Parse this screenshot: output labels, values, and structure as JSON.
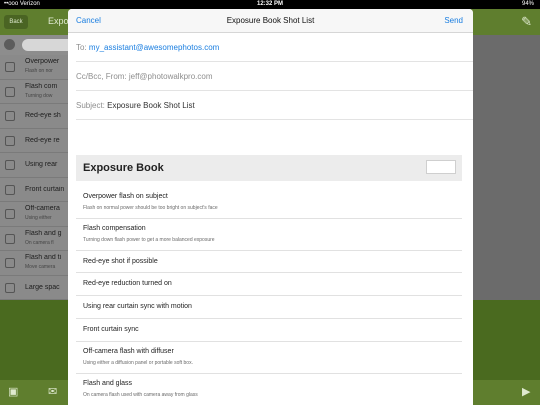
{
  "status_bar": {
    "carrier": "••ooo Verizon",
    "time": "12:32 PM",
    "battery": "94%"
  },
  "background": {
    "back_label": "Back",
    "title": "Expo",
    "list": [
      {
        "title": "Overpower",
        "subtitle": "Flash on nor"
      },
      {
        "title": "Flash com",
        "subtitle": "Turning dow"
      },
      {
        "title": "Red-eye sh",
        "subtitle": ""
      },
      {
        "title": "Red-eye re",
        "subtitle": ""
      },
      {
        "title": "Using rear",
        "subtitle": ""
      },
      {
        "title": "Front curtain",
        "subtitle": ""
      },
      {
        "title": "Off-camera",
        "subtitle": "Using either"
      },
      {
        "title": "Flash and g",
        "subtitle": "On camera fl"
      },
      {
        "title": "Flash and ti",
        "subtitle": "Move camera"
      },
      {
        "title": "Large spac",
        "subtitle": ""
      }
    ]
  },
  "compose": {
    "cancel": "Cancel",
    "title": "Exposure Book Shot List",
    "send": "Send",
    "to_label": "To:",
    "to_value": "my_assistant@awesomephotos.com",
    "ccbcc_label": "Cc/Bcc, From:",
    "from_value": "jeff@photowalkpro.com",
    "subject_label": "Subject:",
    "subject_value": "Exposure Book Shot List",
    "book_title": "Exposure Book",
    "items": [
      {
        "title": "Overpower flash on subject",
        "subtitle": "Flash on normal power should be too bright on subject's face"
      },
      {
        "title": "Flash compensation",
        "subtitle": "Turning down flash power to get a more balanced exposure"
      },
      {
        "title": "Red-eye shot if possible",
        "subtitle": ""
      },
      {
        "title": "Red-eye reduction turned on",
        "subtitle": ""
      },
      {
        "title": "Using rear curtain sync with motion",
        "subtitle": ""
      },
      {
        "title": "Front curtain sync",
        "subtitle": ""
      },
      {
        "title": "Off-camera flash with diffuser",
        "subtitle": "Using either a diffusion panel or portable soft box."
      },
      {
        "title": "Flash and glass",
        "subtitle": "On camera flash used with camera away from glass"
      }
    ]
  },
  "icons": {
    "camera": "camera-icon",
    "mail": "mail-icon",
    "play": "play-icon",
    "edit": "pencil-icon"
  }
}
